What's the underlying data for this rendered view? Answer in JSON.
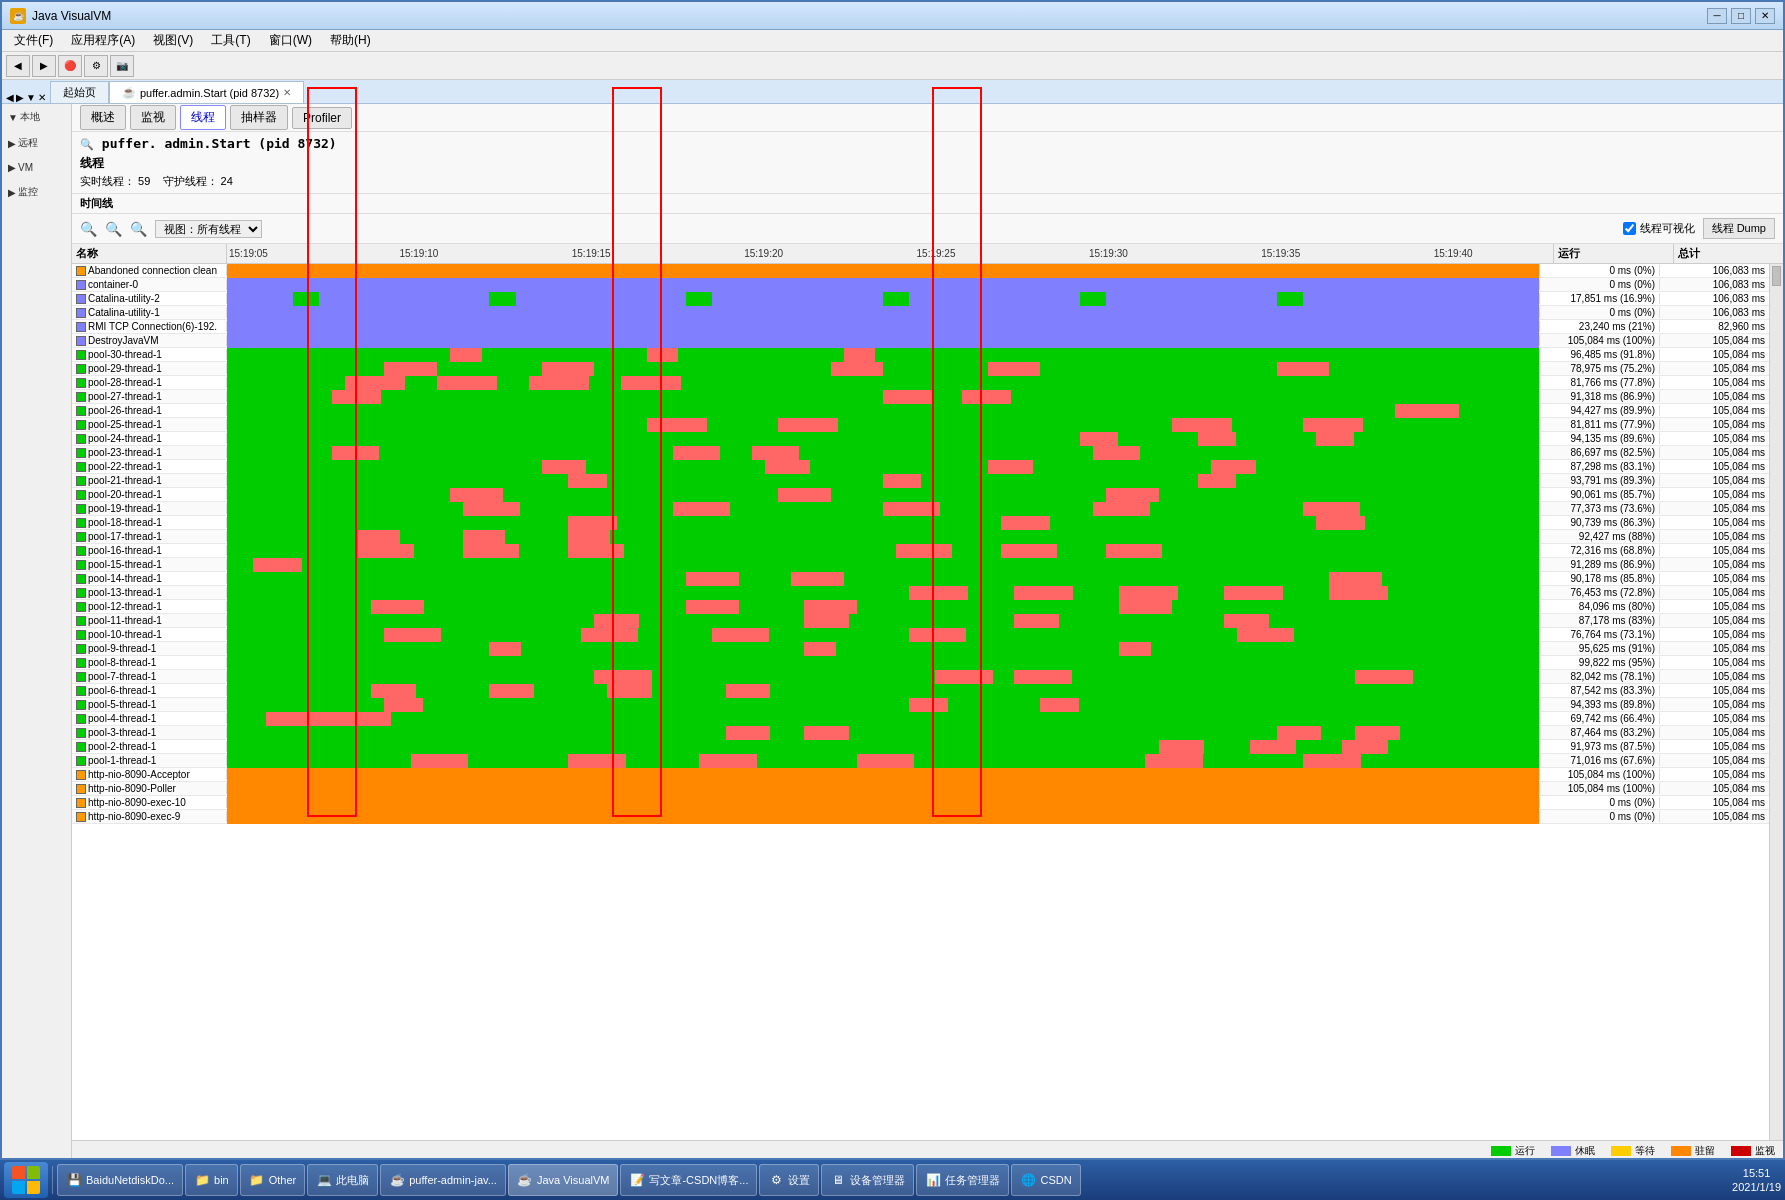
{
  "window": {
    "title": "Java VisualVM",
    "icon": "☕"
  },
  "menubar": {
    "items": [
      "文件(F)",
      "应用程序(A)",
      "视图(V)",
      "工具(T)",
      "窗口(W)",
      "帮助(H)"
    ]
  },
  "tabs": [
    {
      "label": "起始页",
      "active": false
    },
    {
      "label": "puffer.admin.Start (pid 8732)",
      "active": true
    }
  ],
  "subtabs": [
    {
      "label": "概述",
      "active": false
    },
    {
      "label": "监视",
      "active": false
    },
    {
      "label": "线程",
      "active": true
    },
    {
      "label": "抽样器",
      "active": false
    },
    {
      "label": "Profiler",
      "active": false
    }
  ],
  "process_title": "puffer. admin.Start (pid 8732)",
  "section_label": "线程",
  "thread_stats": {
    "realtime_label": "实时线程：",
    "realtime_value": "59",
    "daemon_label": "守护线程：",
    "daemon_value": "24"
  },
  "timeline_label": "时间线",
  "controls": {
    "view_label": "视图：所有线程",
    "thread_visible_label": "✓线程可视化",
    "thread_dump_label": "线程 Dump"
  },
  "header": {
    "name_col": "名称",
    "run_col": "运行",
    "total_col": "总计"
  },
  "time_labels": [
    "15:19:05",
    "15:19:10",
    "15:19:15",
    "15:19:20",
    "15:19:25",
    "15:19:30",
    "15:19:35",
    "15:19:40"
  ],
  "threads": [
    {
      "name": "Abandoned connection clean",
      "color": "#ff9900",
      "run": "0 ms",
      "run_pct": "(0%)",
      "total": "106,083 ms"
    },
    {
      "name": "container-0",
      "color": "#8080ff",
      "run": "0 ms",
      "run_pct": "(0%)",
      "total": "106,083 ms"
    },
    {
      "name": "Catalina-utility-2",
      "color": "#8080ff",
      "run": "17,851 ms",
      "run_pct": "(16.9%)",
      "total": "106,083 ms"
    },
    {
      "name": "Catalina-utility-1",
      "color": "#8080ff",
      "run": "0 ms",
      "run_pct": "(0%)",
      "total": "106,083 ms"
    },
    {
      "name": "RMI TCP Connection(6)-192.",
      "color": "#8080ff",
      "run": "23,240 ms",
      "run_pct": "(21%)",
      "total": "82,960 ms"
    },
    {
      "name": "DestroyJavaVM",
      "color": "#8080ff",
      "run": "105,084 ms",
      "run_pct": "(100%)",
      "total": "105,084 ms"
    },
    {
      "name": "pool-30-thread-1",
      "color": "#00cc00",
      "run": "96,485 ms",
      "run_pct": "(91.8%)",
      "total": "105,084 ms"
    },
    {
      "name": "pool-29-thread-1",
      "color": "#00cc00",
      "run": "78,975 ms",
      "run_pct": "(75.2%)",
      "total": "105,084 ms"
    },
    {
      "name": "pool-28-thread-1",
      "color": "#00cc00",
      "run": "81,766 ms",
      "run_pct": "(77.8%)",
      "total": "105,084 ms"
    },
    {
      "name": "pool-27-thread-1",
      "color": "#00cc00",
      "run": "91,318 ms",
      "run_pct": "(86.9%)",
      "total": "105,084 ms"
    },
    {
      "name": "pool-26-thread-1",
      "color": "#00cc00",
      "run": "94,427 ms",
      "run_pct": "(89.9%)",
      "total": "105,084 ms"
    },
    {
      "name": "pool-25-thread-1",
      "color": "#00cc00",
      "run": "81,811 ms",
      "run_pct": "(77.9%)",
      "total": "105,084 ms"
    },
    {
      "name": "pool-24-thread-1",
      "color": "#00cc00",
      "run": "94,135 ms",
      "run_pct": "(89.6%)",
      "total": "105,084 ms"
    },
    {
      "name": "pool-23-thread-1",
      "color": "#00cc00",
      "run": "86,697 ms",
      "run_pct": "(82.5%)",
      "total": "105,084 ms"
    },
    {
      "name": "pool-22-thread-1",
      "color": "#00cc00",
      "run": "87,298 ms",
      "run_pct": "(83.1%)",
      "total": "105,084 ms"
    },
    {
      "name": "pool-21-thread-1",
      "color": "#00cc00",
      "run": "93,791 ms",
      "run_pct": "(89.3%)",
      "total": "105,084 ms"
    },
    {
      "name": "pool-20-thread-1",
      "color": "#00cc00",
      "run": "90,061 ms",
      "run_pct": "(85.7%)",
      "total": "105,084 ms"
    },
    {
      "name": "pool-19-thread-1",
      "color": "#00cc00",
      "run": "77,373 ms",
      "run_pct": "(73.6%)",
      "total": "105,084 ms"
    },
    {
      "name": "pool-18-thread-1",
      "color": "#00cc00",
      "run": "90,739 ms",
      "run_pct": "(86.3%)",
      "total": "105,084 ms"
    },
    {
      "name": "pool-17-thread-1",
      "color": "#00cc00",
      "run": "92,427 ms",
      "run_pct": "(88%)",
      "total": "105,084 ms"
    },
    {
      "name": "pool-16-thread-1",
      "color": "#00cc00",
      "run": "72,316 ms",
      "run_pct": "(68.8%)",
      "total": "105,084 ms"
    },
    {
      "name": "pool-15-thread-1",
      "color": "#00cc00",
      "run": "91,289 ms",
      "run_pct": "(86.9%)",
      "total": "105,084 ms"
    },
    {
      "name": "pool-14-thread-1",
      "color": "#00cc00",
      "run": "90,178 ms",
      "run_pct": "(85.8%)",
      "total": "105,084 ms"
    },
    {
      "name": "pool-13-thread-1",
      "color": "#00cc00",
      "run": "76,453 ms",
      "run_pct": "(72.8%)",
      "total": "105,084 ms"
    },
    {
      "name": "pool-12-thread-1",
      "color": "#00cc00",
      "run": "84,096 ms",
      "run_pct": "(80%)",
      "total": "105,084 ms"
    },
    {
      "name": "pool-11-thread-1",
      "color": "#00cc00",
      "run": "87,178 ms",
      "run_pct": "(83%)",
      "total": "105,084 ms"
    },
    {
      "name": "pool-10-thread-1",
      "color": "#00cc00",
      "run": "76,764 ms",
      "run_pct": "(73.1%)",
      "total": "105,084 ms"
    },
    {
      "name": "pool-9-thread-1",
      "color": "#00cc00",
      "run": "95,625 ms",
      "run_pct": "(91%)",
      "total": "105,084 ms"
    },
    {
      "name": "pool-8-thread-1",
      "color": "#00cc00",
      "run": "99,822 ms",
      "run_pct": "(95%)",
      "total": "105,084 ms"
    },
    {
      "name": "pool-7-thread-1",
      "color": "#00cc00",
      "run": "82,042 ms",
      "run_pct": "(78.1%)",
      "total": "105,084 ms"
    },
    {
      "name": "pool-6-thread-1",
      "color": "#00cc00",
      "run": "87,542 ms",
      "run_pct": "(83.3%)",
      "total": "105,084 ms"
    },
    {
      "name": "pool-5-thread-1",
      "color": "#00cc00",
      "run": "94,393 ms",
      "run_pct": "(89.8%)",
      "total": "105,084 ms"
    },
    {
      "name": "pool-4-thread-1",
      "color": "#00cc00",
      "run": "69,742 ms",
      "run_pct": "(66.4%)",
      "total": "105,084 ms"
    },
    {
      "name": "pool-3-thread-1",
      "color": "#00cc00",
      "run": "87,464 ms",
      "run_pct": "(83.2%)",
      "total": "105,084 ms"
    },
    {
      "name": "pool-2-thread-1",
      "color": "#00cc00",
      "run": "91,973 ms",
      "run_pct": "(87.5%)",
      "total": "105,084 ms"
    },
    {
      "name": "pool-1-thread-1",
      "color": "#00cc00",
      "run": "71,016 ms",
      "run_pct": "(67.6%)",
      "total": "105,084 ms"
    },
    {
      "name": "http-nio-8090-Acceptor",
      "color": "#ff9900",
      "run": "105,084 ms",
      "run_pct": "(100%)",
      "total": "105,084 ms"
    },
    {
      "name": "http-nio-8090-Poller",
      "color": "#ff9900",
      "run": "105,084 ms",
      "run_pct": "(100%)",
      "total": "105,084 ms"
    },
    {
      "name": "http-nio-8090-exec-10",
      "color": "#ff9900",
      "run": "0 ms",
      "run_pct": "(0%)",
      "total": "105,084 ms"
    },
    {
      "name": "http-nio-8090-exec-9",
      "color": "#ff9900",
      "run": "0 ms",
      "run_pct": "(0%)",
      "total": "105,084 ms"
    }
  ],
  "legend": [
    {
      "label": "运行",
      "color": "#00cc00"
    },
    {
      "label": "休眠",
      "color": "#8080ff"
    },
    {
      "label": "等待",
      "color": "#ffcc00"
    },
    {
      "label": "驻留",
      "color": "#ff8800"
    },
    {
      "label": "监视",
      "color": "#cc0000"
    }
  ],
  "sidebar": {
    "local_label": "本地",
    "remote_label": "远程",
    "vm_label": "VM",
    "monitor_label": "监控"
  },
  "taskbar": {
    "items": [
      {
        "label": "BaiduNetdiskDo...",
        "icon": "💾"
      },
      {
        "label": "bin",
        "icon": "📁"
      },
      {
        "label": "Other",
        "icon": "📁"
      },
      {
        "label": "此电脑",
        "icon": "💻"
      },
      {
        "label": "puffer-admin-jav...",
        "icon": "☕"
      },
      {
        "label": "Java VisualVM",
        "icon": "☕"
      },
      {
        "label": "写文章-CSDN博客...",
        "icon": "📝"
      },
      {
        "label": "设置",
        "icon": "⚙"
      },
      {
        "label": "设备管理器",
        "icon": "🖥"
      },
      {
        "label": "任务管理器",
        "icon": "📊"
      },
      {
        "label": "CSDN",
        "icon": "🌐"
      }
    ],
    "time": "15:51",
    "date": "2021/1/19"
  }
}
